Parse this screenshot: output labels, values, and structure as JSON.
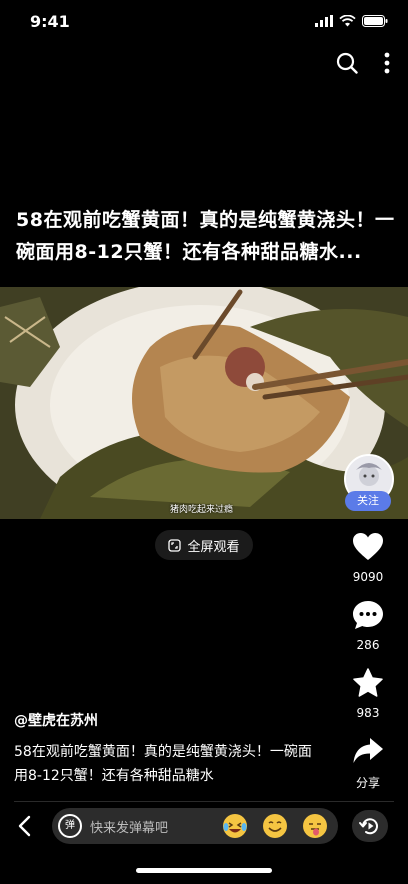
{
  "status_bar": {
    "time": "9:41"
  },
  "video": {
    "headline": "58在观前吃蟹黄面！真的是纯蟹黄浇头！一碗面用8-12只蟹！还有各种甜品糖水...",
    "subtitle": "猪肉吃起来过瘾",
    "follow_label": "关注",
    "fullscreen_label": "全屏观看"
  },
  "actions": {
    "likes": "9090",
    "comments": "286",
    "favorites": "983",
    "share_label": "分享"
  },
  "post": {
    "author": "@壁虎在苏州",
    "description": "58在观前吃蟹黄面！真的是纯蟹黄浇头！一碗面用8-12只蟹！还有各种甜品糖水"
  },
  "bottom_bar": {
    "danmaku_toggle": "弹",
    "danmaku_placeholder": "快来发弹幕吧",
    "emojis": [
      "laughing-crying-emoji",
      "grin-emoji",
      "tongue-emoji"
    ]
  }
}
